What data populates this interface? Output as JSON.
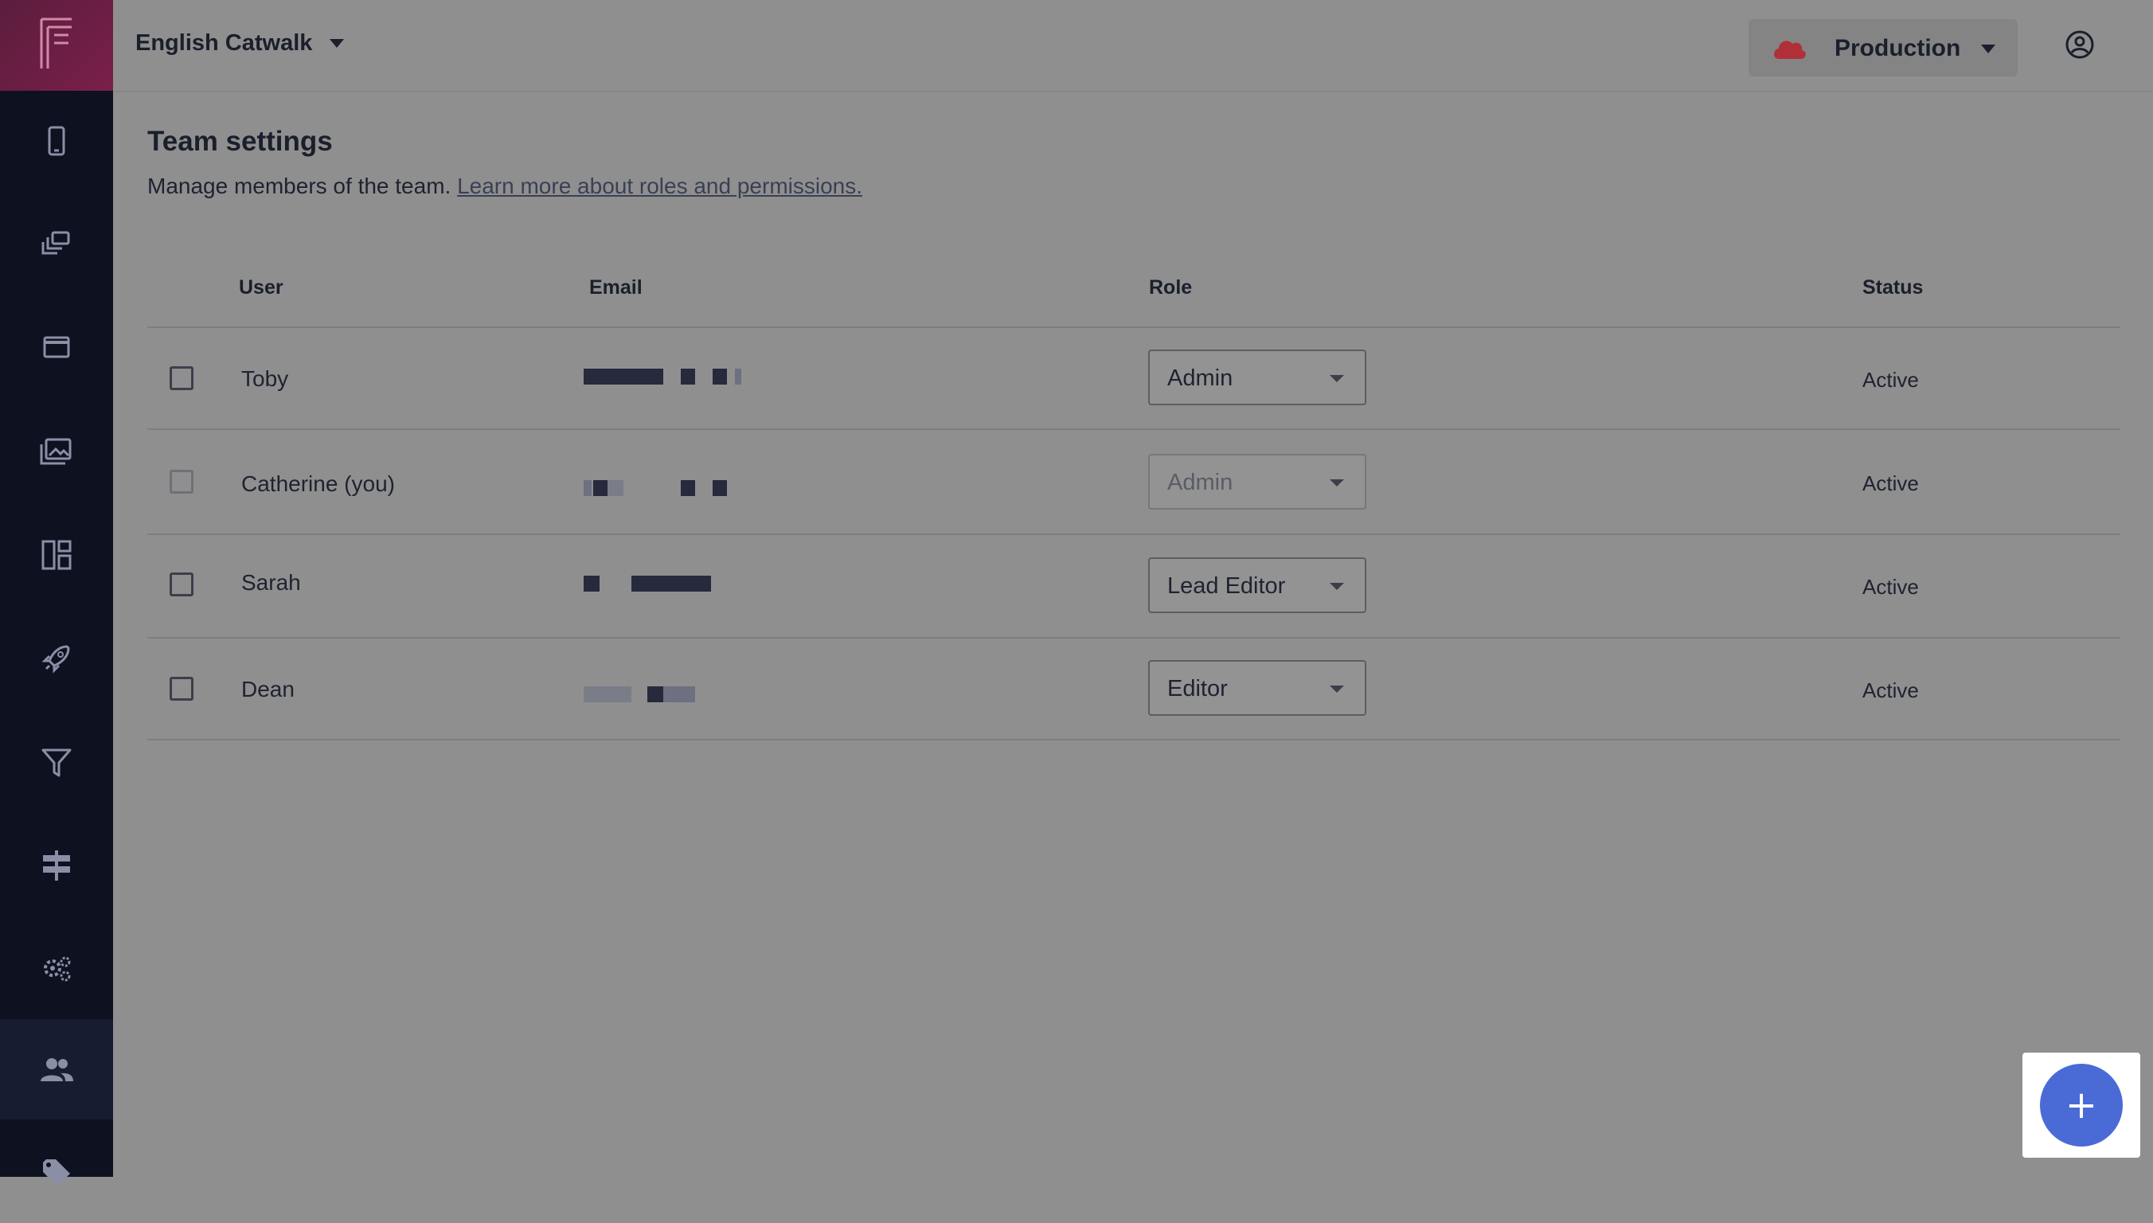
{
  "header": {
    "project_name": "English Catwalk",
    "environment": "Production"
  },
  "page": {
    "title": "Team settings",
    "subtitle": "Manage members of the team.",
    "learn_more_link": "Learn more about roles and permissions."
  },
  "table": {
    "columns": [
      "User",
      "Email",
      "Role",
      "Status"
    ],
    "rows": [
      {
        "user": "Toby",
        "role": "Admin",
        "status": "Active"
      },
      {
        "user": "Catherine (you)",
        "role": "Admin",
        "status": "Active"
      },
      {
        "user": "Sarah",
        "role": "Lead Editor",
        "status": "Active"
      },
      {
        "user": "Dean",
        "role": "Editor",
        "status": "Active"
      }
    ]
  },
  "fab": {
    "label": "+"
  },
  "colors": {
    "accent": "#4a6bd6",
    "sidebar": "#0d1120",
    "logo": "#7a1f4a",
    "env_cloud": "#b0303a"
  },
  "sidebar": {
    "icons": [
      "mobile-icon",
      "gallery-stack-icon",
      "window-icon",
      "images-icon",
      "dashboard-icon",
      "rocket-icon",
      "filter-icon",
      "signpost-icon",
      "settings-icon",
      "team-icon",
      "tag-icon"
    ],
    "active": "team-icon"
  }
}
